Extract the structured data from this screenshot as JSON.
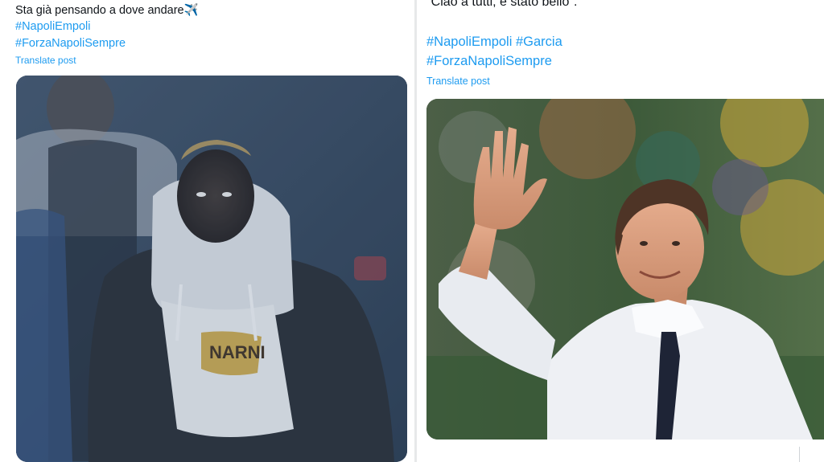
{
  "left_post": {
    "text": "Sta già pensando a dove andare✈️",
    "hashtags": [
      "#NapoliEmpoli",
      "#ForzaNapoliSempre"
    ],
    "translate_label": "Translate post",
    "image": {
      "shirt_text": "NARNI"
    }
  },
  "right_post": {
    "text": "\"Ciao a tutti, è stato bello\".",
    "hashtags_line1": "#NapoliEmpoli #Garcia",
    "hashtags_line2": "#ForzaNapoliSempre",
    "translate_label": "Translate post"
  },
  "colors": {
    "link": "#1d9bf0",
    "text": "#0f1419",
    "divider": "#e7e9ea"
  }
}
